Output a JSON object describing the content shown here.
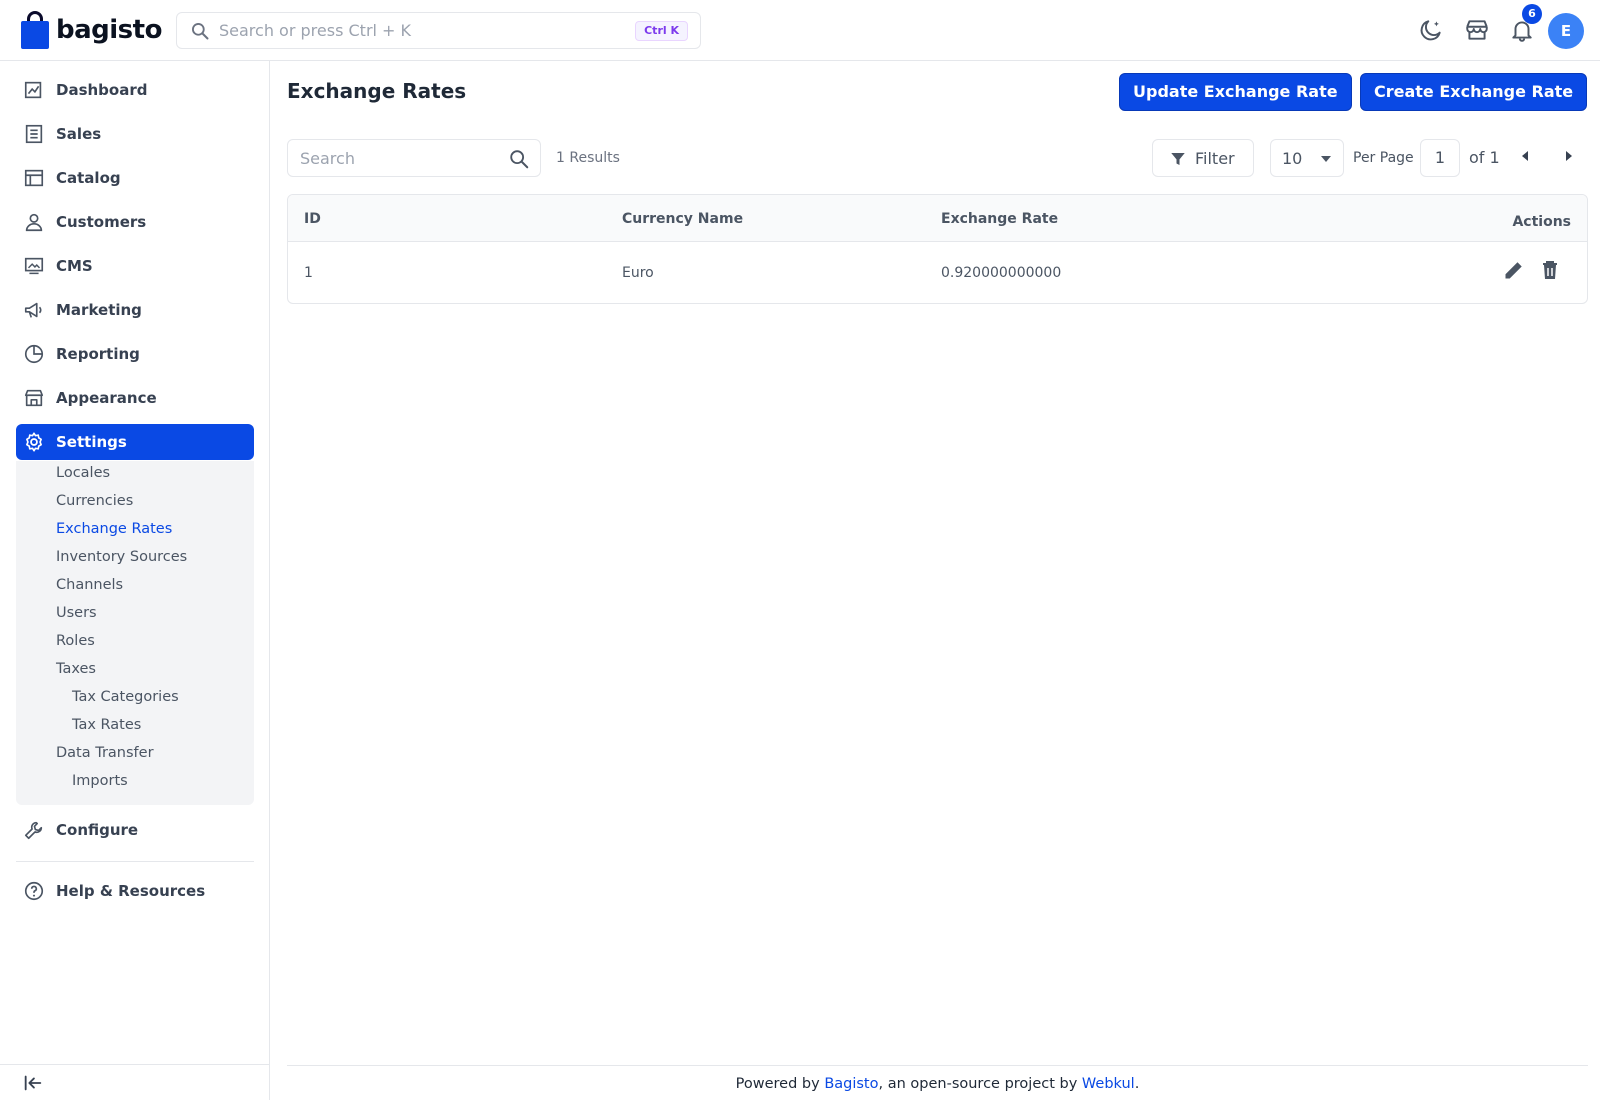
{
  "brand": {
    "name": "bagisto",
    "color": "#0a49e4"
  },
  "header": {
    "search_placeholder": "Search or press Ctrl + K",
    "shortcut": "Ctrl K",
    "notifications_count": "6",
    "avatar_initial": "E",
    "icons": [
      "moon-icon",
      "store-icon",
      "bell-icon"
    ]
  },
  "sidebar": {
    "items": [
      {
        "label": "Dashboard",
        "icon": "dashboard-icon"
      },
      {
        "label": "Sales",
        "icon": "sales-icon"
      },
      {
        "label": "Catalog",
        "icon": "catalog-icon"
      },
      {
        "label": "Customers",
        "icon": "customers-icon"
      },
      {
        "label": "CMS",
        "icon": "cms-icon"
      },
      {
        "label": "Marketing",
        "icon": "megaphone-icon"
      },
      {
        "label": "Reporting",
        "icon": "reporting-icon"
      },
      {
        "label": "Appearance",
        "icon": "appearance-icon"
      },
      {
        "label": "Settings",
        "icon": "gear-icon",
        "active": true
      },
      {
        "label": "Configure",
        "icon": "wrench-icon"
      },
      {
        "label": "Help & Resources",
        "icon": "help-icon"
      }
    ],
    "settings_submenu": [
      {
        "label": "Locales"
      },
      {
        "label": "Currencies"
      },
      {
        "label": "Exchange Rates",
        "active": true
      },
      {
        "label": "Inventory Sources"
      },
      {
        "label": "Channels"
      },
      {
        "label": "Users"
      },
      {
        "label": "Roles"
      },
      {
        "label": "Taxes"
      },
      {
        "label": "Tax Categories"
      },
      {
        "label": "Tax Rates"
      },
      {
        "label": "Data Transfer"
      },
      {
        "label": "Imports"
      }
    ]
  },
  "main": {
    "title": "Exchange Rates",
    "update_button": "Update Exchange Rate",
    "create_button": "Create Exchange Rate",
    "search_placeholder": "Search",
    "results": "1 Results",
    "filter_label": "Filter",
    "per_page_value": "10",
    "per_page_label": "Per Page",
    "page_number": "1",
    "page_total": "of 1"
  },
  "table": {
    "columns": [
      "ID",
      "Currency Name",
      "Exchange Rate",
      "Actions"
    ],
    "rows": [
      {
        "id": "1",
        "currency": "Euro",
        "rate": "0.920000000000"
      }
    ]
  },
  "footer": {
    "prefix": "Powered by ",
    "link1": "Bagisto",
    "middle": ", an open-source project by ",
    "link2": "Webkul",
    "suffix": "."
  }
}
